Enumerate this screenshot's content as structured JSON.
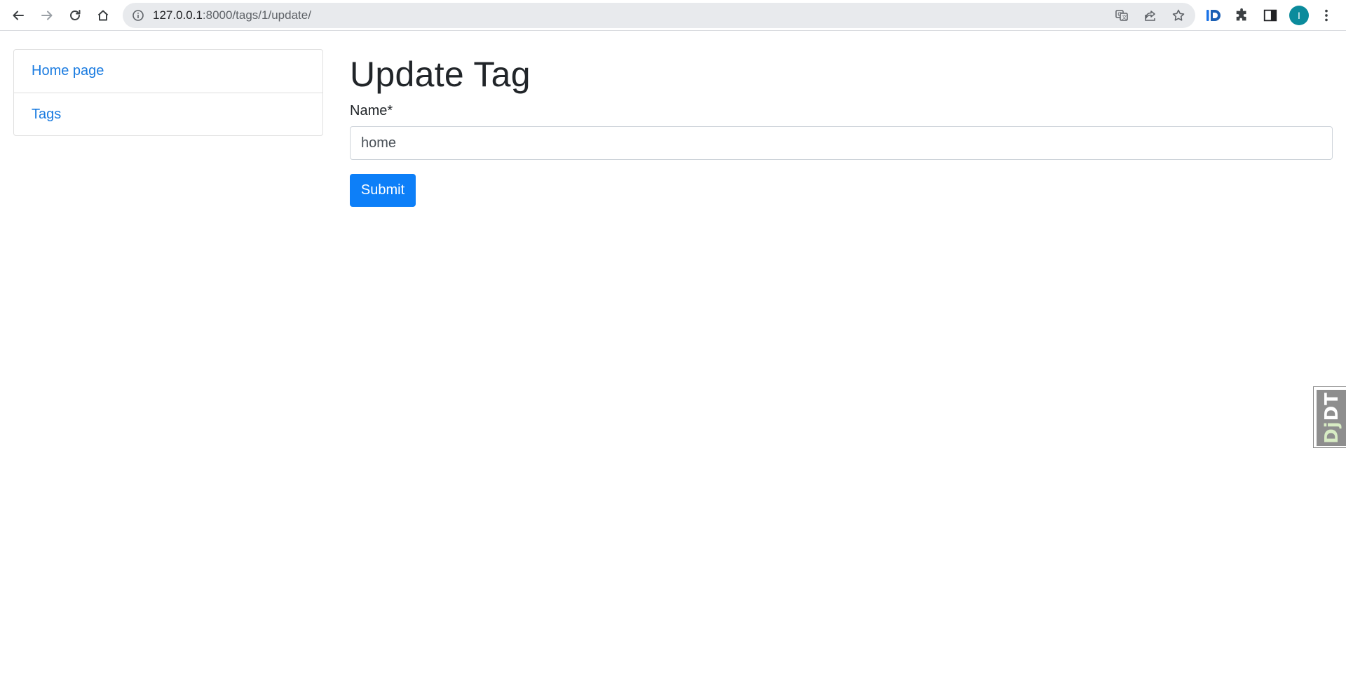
{
  "browser": {
    "url_host": "127.0.0.1",
    "url_rest": ":8000/tags/1/update/",
    "profile_initial": "I",
    "icons": {
      "back": "arrow-left-icon",
      "forward": "arrow-right-icon",
      "reload": "reload-icon",
      "home": "home-icon",
      "info": "info-icon",
      "translate": "translate-icon",
      "share": "share-icon",
      "bookmark": "star-icon",
      "extension_id": "id-extension-icon",
      "extensions": "puzzle-icon",
      "side_panel": "side-panel-icon",
      "menu": "kebab-menu-icon"
    },
    "colors": {
      "avatar": "#0b8b9c"
    }
  },
  "sidebar": {
    "items": [
      {
        "label": "Home page"
      },
      {
        "label": "Tags"
      }
    ]
  },
  "main": {
    "title": "Update Tag",
    "form": {
      "name_label": "Name*",
      "name_value": "home",
      "submit_label": "Submit"
    }
  },
  "debug_toolbar": {
    "label_dj": "Dj",
    "label_dt": "DT"
  },
  "colors": {
    "link": "#1a7be0",
    "primary_button": "#0d7ff8"
  }
}
